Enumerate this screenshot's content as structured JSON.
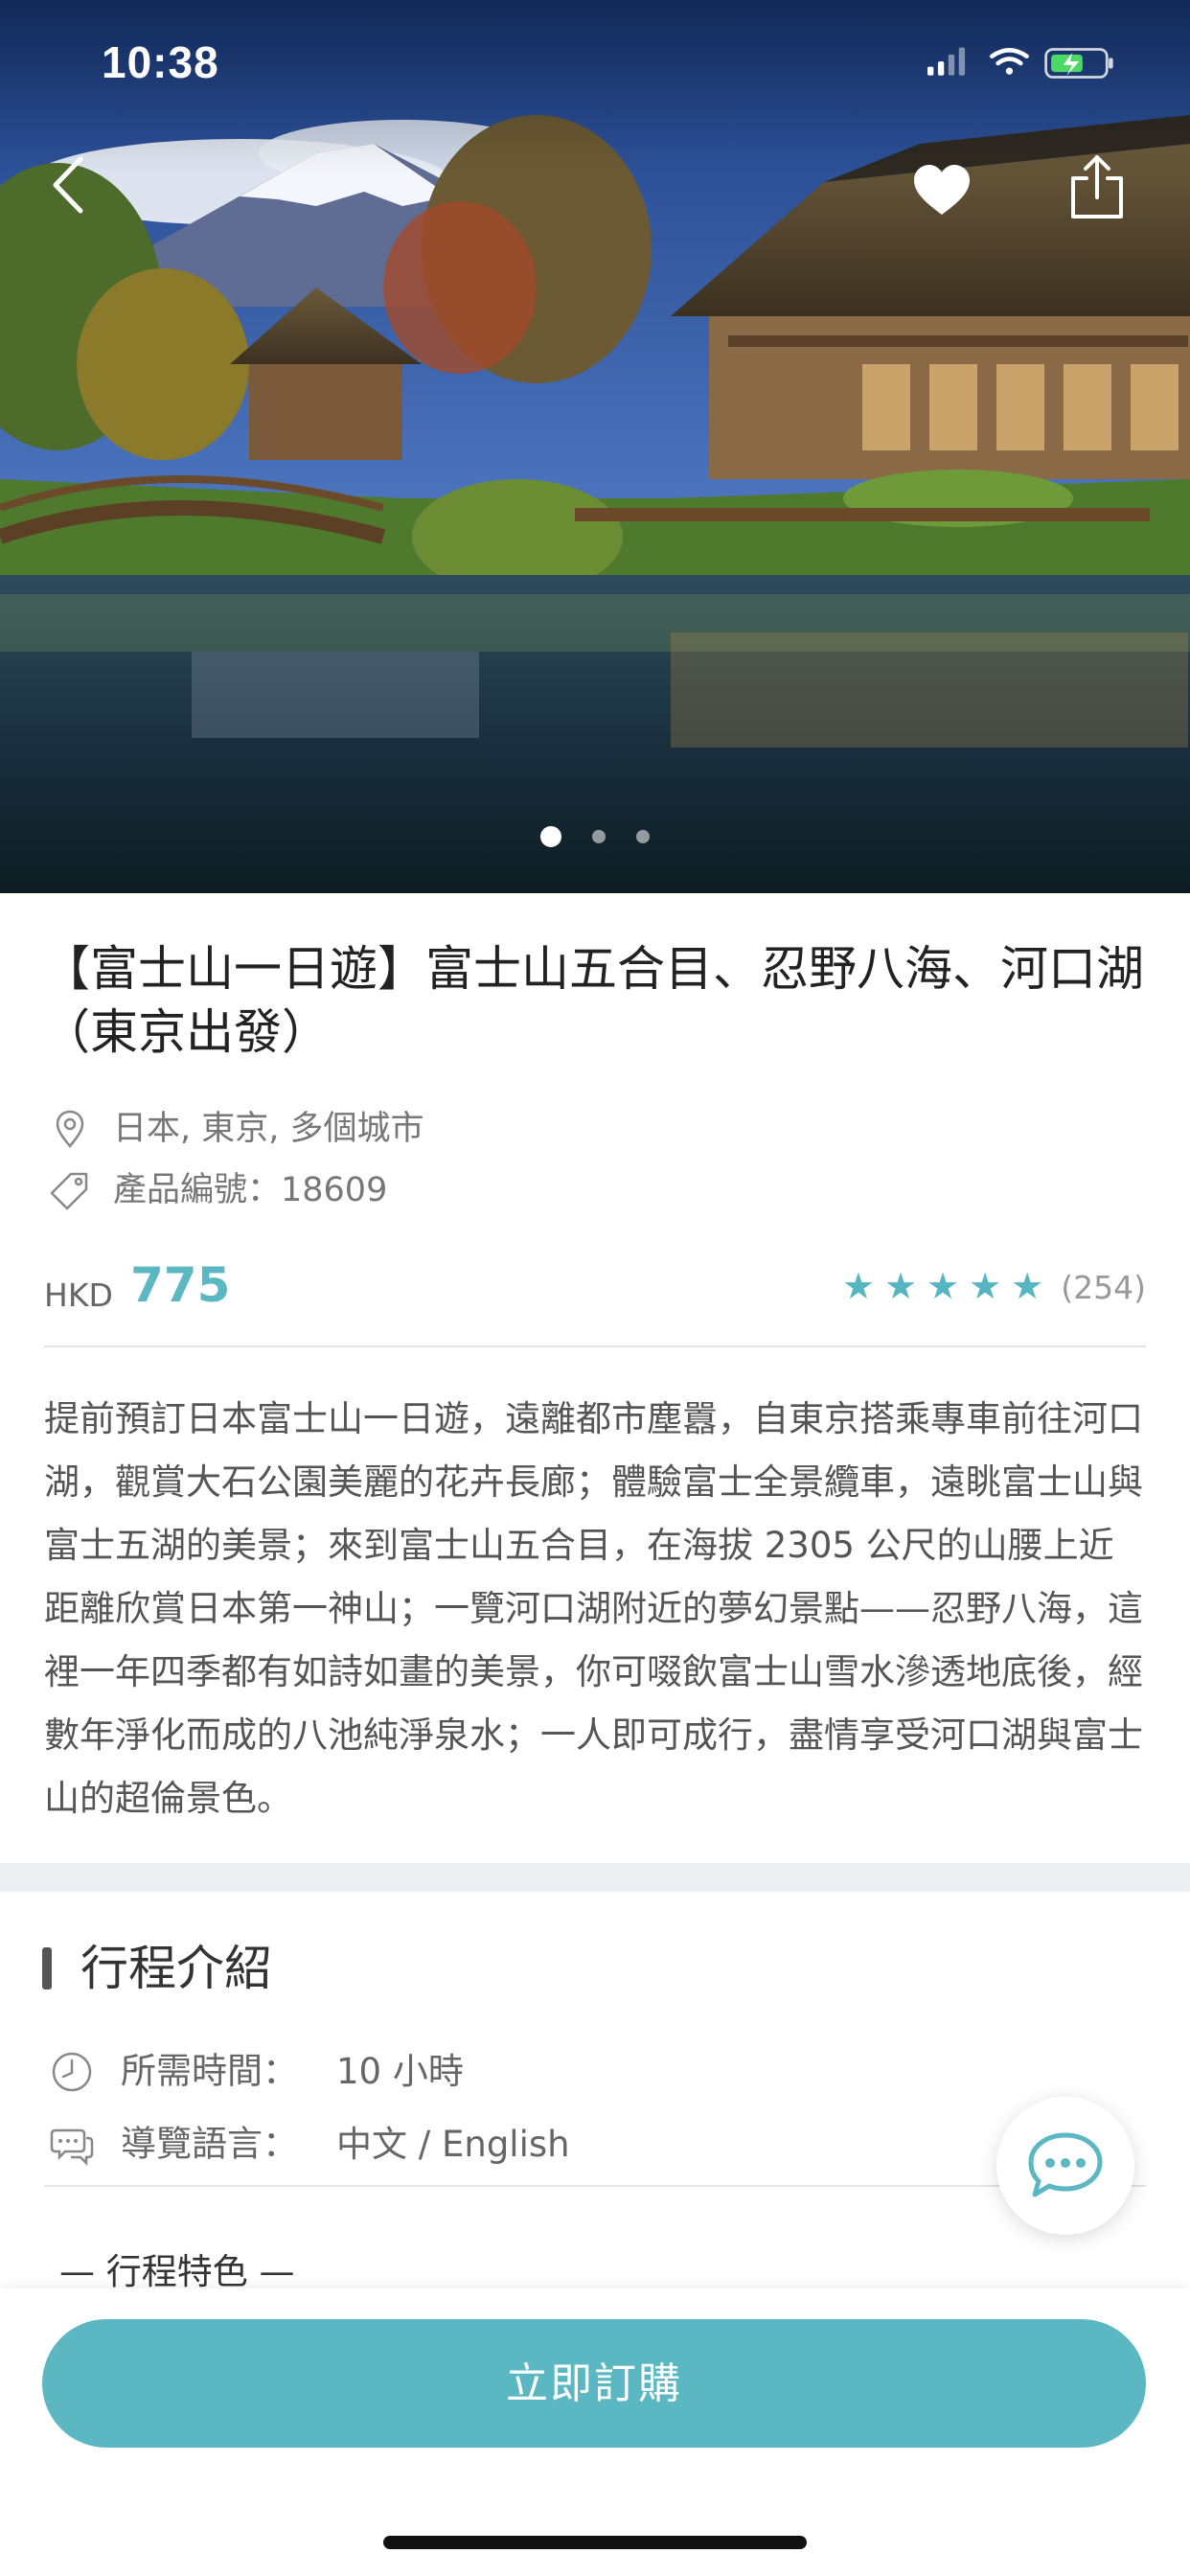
{
  "status_bar": {
    "time": "10:38"
  },
  "hero": {
    "image_icon": "mount-fuji-oshino-hakkai-photo",
    "nav": {
      "back_icon": "chevron-left-icon",
      "favorite_icon": "heart-icon",
      "share_icon": "share-icon"
    },
    "carousel": {
      "total": 3,
      "active": 1
    }
  },
  "product": {
    "title": "【富士山一日遊】富士山五合目、忍野八海、河口湖（東京出發）",
    "location": "日本, 東京, 多個城市",
    "product_code": "產品編號：18609",
    "currency": "HKD",
    "price": "775",
    "rating_stars": "★★★★★",
    "review_count": "(254)",
    "description": "提前預訂日本富士山一日遊，遠離都市塵囂，自東京搭乘專車前往河口湖，觀賞大石公園美麗的花卉長廊；體驗富士全景纜車，遠眺富士山與富士五湖的美景；來到富士山五合目，在海拔 2305 公尺的山腰上近距離欣賞日本第一神山；一覽河口湖附近的夢幻景點——忍野八海，這裡一年四季都有如詩如畫的美景，你可啜飲富士山雪水滲透地底後，經數年淨化而成的八池純淨泉水；一人即可成行，盡情享受河口湖與富士山的超倫景色。"
  },
  "itinerary": {
    "section_title": "行程介紹",
    "duration_label": "所需時間：",
    "duration_value": "10 小時",
    "language_label": "導覽語言：",
    "language_value": "中文 / English",
    "features_heading": "— 行程特色 —"
  },
  "actions": {
    "buy_label": "立即訂購"
  },
  "colors": {
    "accent": "#5bb8c3",
    "price": "#5bb7c2",
    "divider_band": "#eeeff3"
  }
}
